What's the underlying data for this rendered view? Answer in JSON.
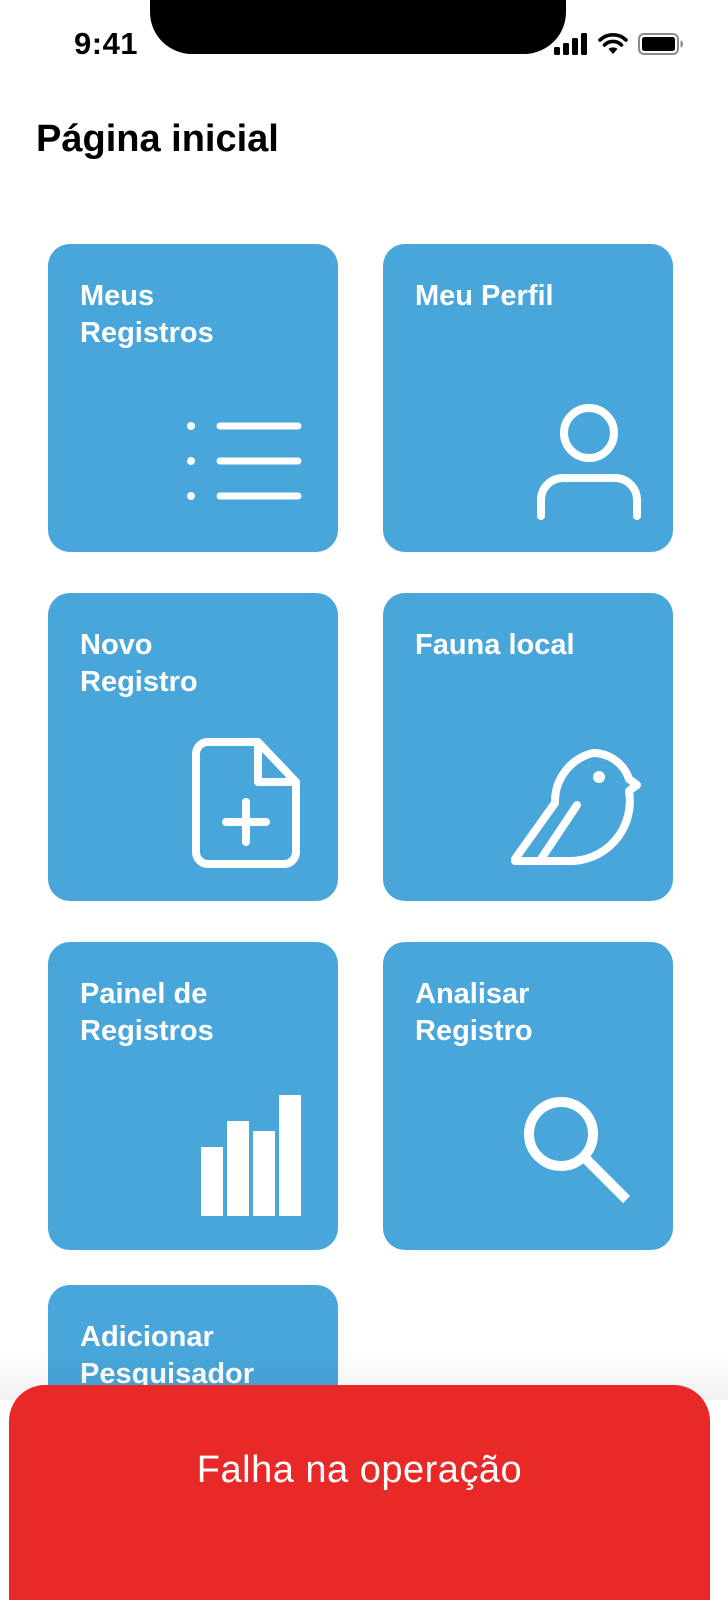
{
  "status_bar": {
    "time": "9:41",
    "icons": [
      "signal-icon",
      "wifi-icon",
      "battery-icon"
    ]
  },
  "page": {
    "title": "Página inicial"
  },
  "tiles": [
    {
      "label": "Meus\nRegistros",
      "icon": "list-icon"
    },
    {
      "label": "Meu Perfil",
      "icon": "user-icon"
    },
    {
      "label": "Novo\nRegistro",
      "icon": "file-add-icon"
    },
    {
      "label": "Fauna local",
      "icon": "bird-icon"
    },
    {
      "label": "Painel de\nRegistros",
      "icon": "bar-chart-icon"
    },
    {
      "label": "Analisar\nRegistro",
      "icon": "search-icon"
    },
    {
      "label": "Adicionar\nPesquisador",
      "icon": ""
    }
  ],
  "toast": {
    "message": "Falha na operação"
  },
  "colors": {
    "tile": "#48a6da",
    "toast": "#e92828",
    "icon": "#ffffff"
  }
}
